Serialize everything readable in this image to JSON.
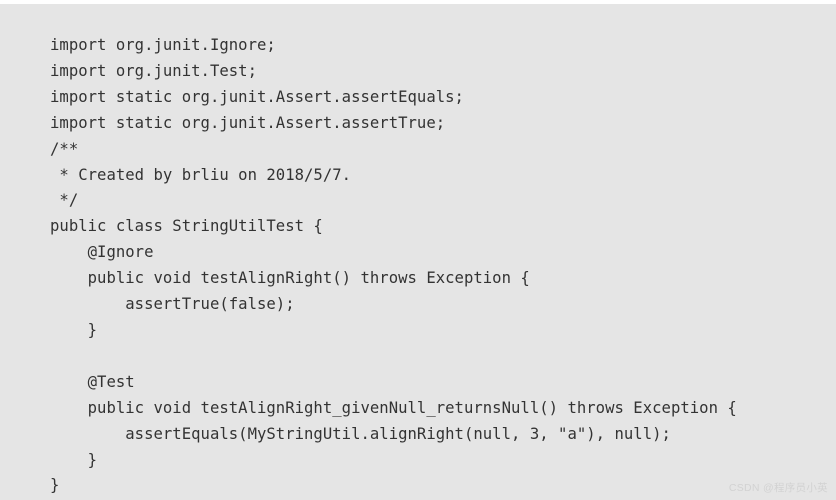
{
  "document": {
    "kind": "java-source-code-listing",
    "language": "Java",
    "background_color": "#e5e5e5",
    "text_color": "#333333",
    "page_background": "#ffffff"
  },
  "code": {
    "lines": [
      "import org.junit.Ignore;",
      "import org.junit.Test;",
      "import static org.junit.Assert.assertEquals;",
      "import static org.junit.Assert.assertTrue;",
      "/**",
      " * Created by brliu on 2018/5/7.",
      " */",
      "public class StringUtilTest {",
      "    @Ignore",
      "    public void testAlignRight() throws Exception {",
      "        assertTrue(false);",
      "    }",
      "",
      "    @Test",
      "    public void testAlignRight_givenNull_returnsNull() throws Exception {",
      "        assertEquals(MyStringUtil.alignRight(null, 3, \"a\"), null);",
      "    }",
      "}"
    ]
  },
  "watermark": {
    "text": "CSDN @程序员小英",
    "color": "#d2d2d2"
  }
}
